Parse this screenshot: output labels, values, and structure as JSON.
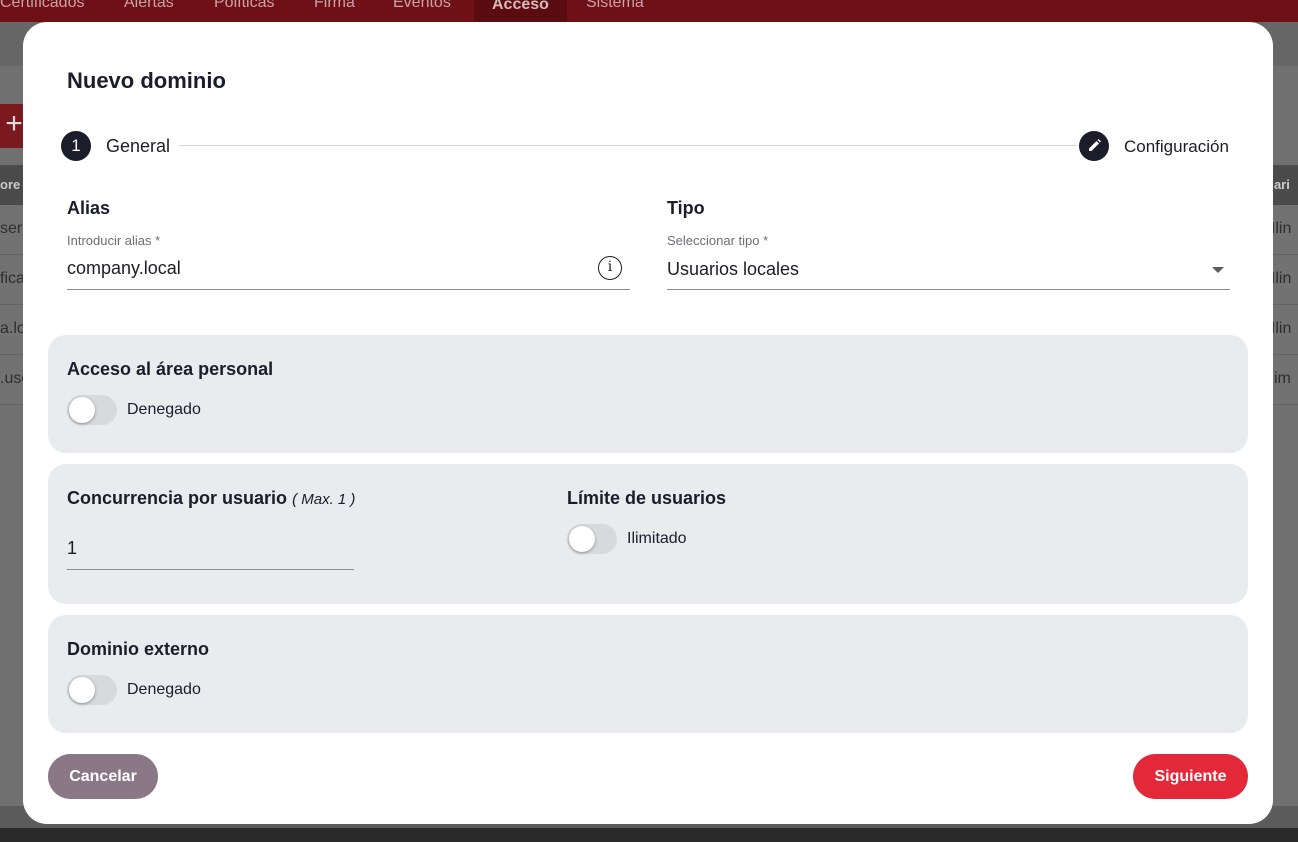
{
  "background": {
    "nav": [
      "Certificados",
      "Alertas",
      "Políticas",
      "Firma",
      "Eventos",
      "Acceso",
      "Sistema"
    ],
    "active_nav": "Acceso",
    "header_left": "ore",
    "header_right": "uari",
    "rows_left": [
      "sers",
      "fica",
      "a.lo",
      ".use"
    ],
    "rows_right": [
      "/ Ilin",
      "/ Ilin",
      "/ Ilin",
      "Ilim"
    ],
    "add_symbol": "+"
  },
  "modal": {
    "title": "Nuevo dominio",
    "stepper": {
      "step1_number": "1",
      "step1_label": "General",
      "step2_label": "Configuración",
      "step2_icon": "pencil-icon"
    },
    "alias": {
      "title": "Alias",
      "label": "Introducir alias *",
      "value": "company.local",
      "info_icon": "i"
    },
    "tipo": {
      "title": "Tipo",
      "label": "Seleccionar tipo *",
      "value": "Usuarios locales"
    },
    "acceso": {
      "title": "Acceso al área personal",
      "toggle_label": "Denegado",
      "enabled": false
    },
    "concurrencia": {
      "title": "Concurrencia por usuario",
      "hint": "( Max. 1 )",
      "value": "1"
    },
    "limite": {
      "title": "Límite de usuarios",
      "toggle_label": "Ilimitado",
      "enabled": false
    },
    "externo": {
      "title": "Dominio externo",
      "toggle_label": "Denegado",
      "enabled": false
    },
    "buttons": {
      "cancel": "Cancelar",
      "next": "Siguiente"
    },
    "colors": {
      "primary": "#e3283a",
      "cancel": "#8b7886",
      "dark": "#1c1c2a",
      "section_bg": "#e8ecef"
    }
  }
}
